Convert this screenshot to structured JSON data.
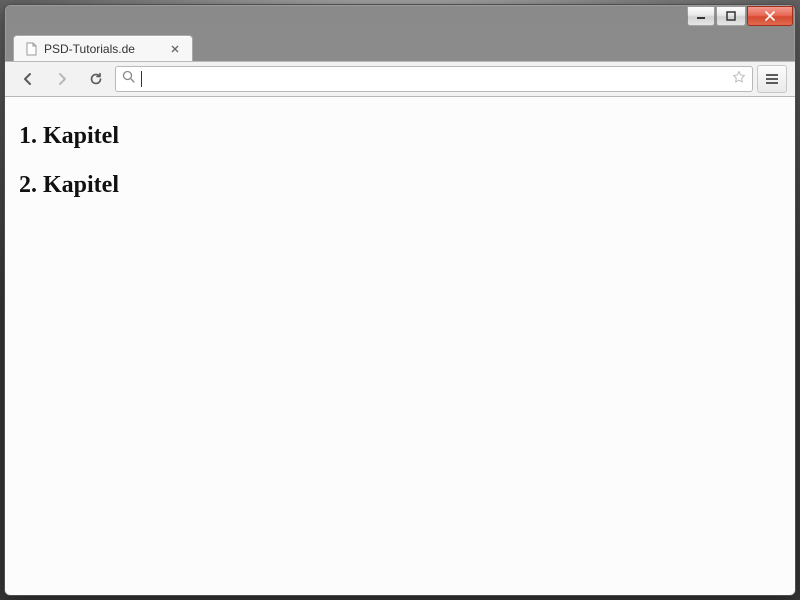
{
  "window": {
    "tab_title": "PSD-Tutorials.de"
  },
  "toolbar": {
    "address_value": ""
  },
  "content": {
    "heading1": "1. Kapitel",
    "heading2": "2. Kapitel"
  }
}
